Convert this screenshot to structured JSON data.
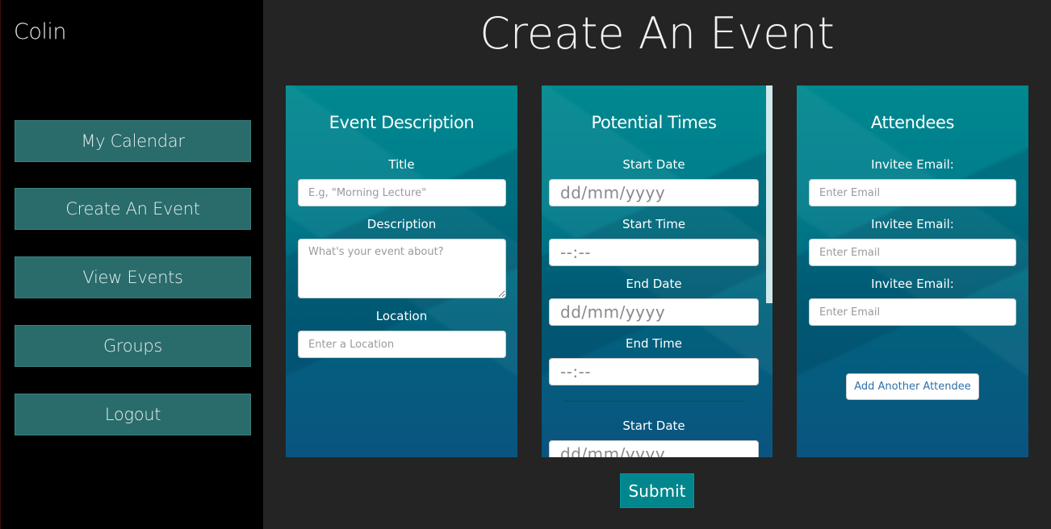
{
  "sidebar": {
    "user_name": "Colin",
    "items": [
      {
        "label": "My Calendar"
      },
      {
        "label": "Create An Event"
      },
      {
        "label": "View Events"
      },
      {
        "label": "Groups"
      },
      {
        "label": "Logout"
      }
    ]
  },
  "page_title": "Create An Event",
  "event_description": {
    "heading": "Event Description",
    "title_label": "Title",
    "title_placeholder": "E.g, \"Morning Lecture\"",
    "description_label": "Description",
    "description_placeholder": "What's your event about?",
    "location_label": "Location",
    "location_placeholder": "Enter a Location"
  },
  "potential_times": {
    "heading": "Potential Times",
    "start_date_label": "Start Date",
    "start_date_value": "dd/mm/yyyy",
    "start_time_label": "Start Time",
    "start_time_value": "--:--",
    "end_date_label": "End Date",
    "end_date_value": "dd/mm/yyyy",
    "end_time_label": "End Time",
    "end_time_value": "--:--",
    "start_date_label_2": "Start Date",
    "start_date_value_2": "dd/mm/yyyy"
  },
  "attendees": {
    "heading": "Attendees",
    "invitees": [
      {
        "label": "Invitee Email:",
        "placeholder": "Enter Email"
      },
      {
        "label": "Invitee Email:",
        "placeholder": "Enter Email"
      },
      {
        "label": "Invitee Email:",
        "placeholder": "Enter Email"
      }
    ],
    "add_button": "Add Another Attendee"
  },
  "submit_label": "Submit",
  "colors": {
    "sidebar_bg": "#000000",
    "nav_button": "#2a6b6b",
    "page_bg": "#242424",
    "panel_teal": "#00888f",
    "submit": "#00868c"
  }
}
